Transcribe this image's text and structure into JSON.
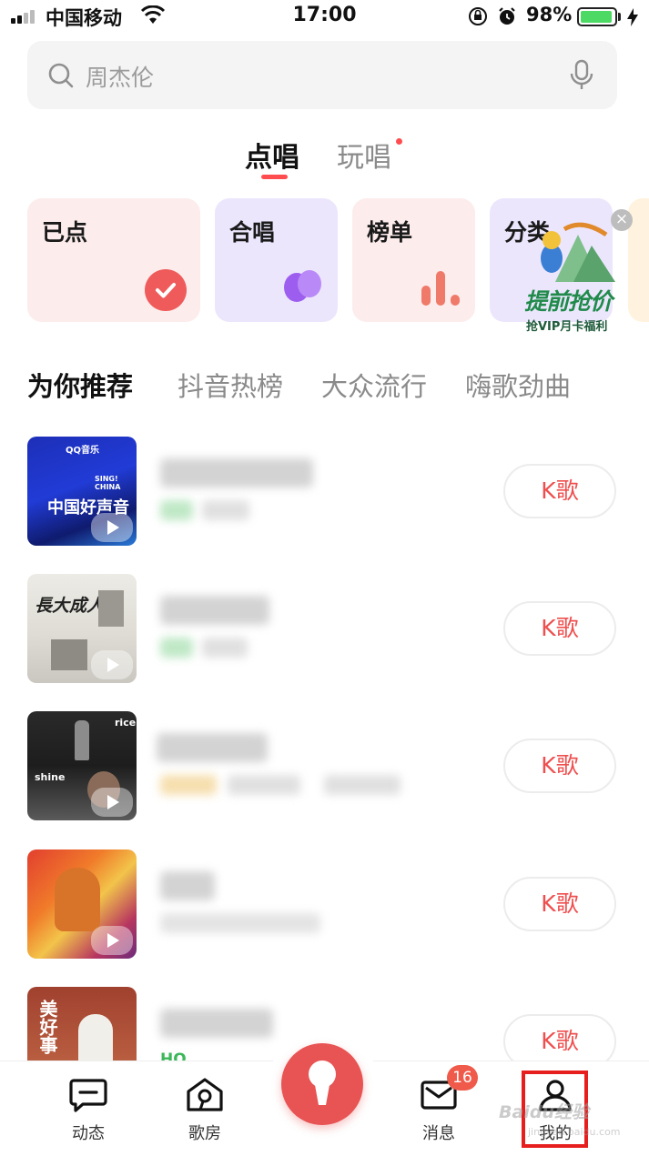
{
  "status_bar": {
    "carrier": "中国移动",
    "time": "17:00",
    "battery": "98%",
    "battery_level": 0.98
  },
  "search": {
    "placeholder": "周杰伦"
  },
  "main_tabs": [
    {
      "label": "点唱",
      "active": true
    },
    {
      "label": "玩唱",
      "has_dot": true
    }
  ],
  "categories": [
    {
      "label": "已点"
    },
    {
      "label": "合唱"
    },
    {
      "label": "榜单"
    },
    {
      "label": "分类"
    }
  ],
  "promo": {
    "main": "提前抢价",
    "sub": "抢VIP月卡福利"
  },
  "rec_tabs": [
    {
      "label": "为你推荐",
      "active": true
    },
    {
      "label": "抖音热榜"
    },
    {
      "label": "大众流行"
    },
    {
      "label": "嗨歌劲曲"
    }
  ],
  "songs": [
    {
      "cover_title": "中国好声音",
      "cover_brand": "QQ音乐",
      "cover_tag": "SING! CHINA",
      "k_label": "K歌"
    },
    {
      "cover_title": "長大成人",
      "k_label": "K歌"
    },
    {
      "cover_title": "rice",
      "cover_sub": "shine",
      "k_label": "K歌"
    },
    {
      "k_label": "K歌"
    },
    {
      "cover_title": "美好事",
      "tag": "HQ",
      "k_label": "K歌"
    }
  ],
  "nav": [
    {
      "label": "动态"
    },
    {
      "label": "歌房"
    },
    {
      "label": "消息",
      "badge": "16"
    },
    {
      "label": "我的"
    }
  ],
  "watermark": {
    "text": "Baidu经验",
    "sub": "jingyan.baidu.com"
  },
  "colors": {
    "accent": "#ef4f4f",
    "highlight_box": "#e61e1e",
    "tab_indicator": "#ff4d4f"
  }
}
